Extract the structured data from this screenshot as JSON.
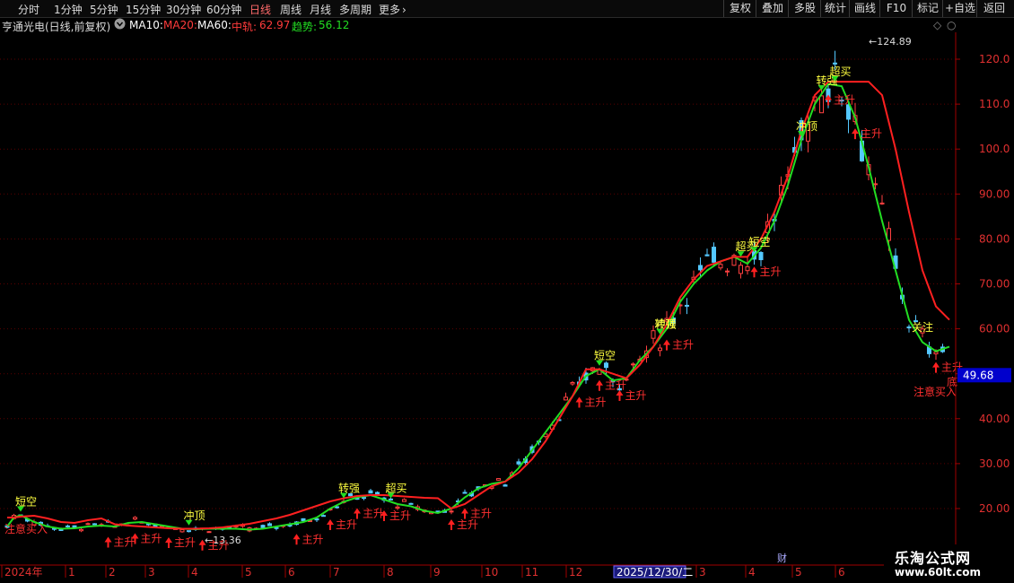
{
  "toolbar": {
    "periods": [
      {
        "label": "分时"
      },
      {
        "label": "1分钟"
      },
      {
        "label": "5分钟"
      },
      {
        "label": "15分钟"
      },
      {
        "label": "30分钟"
      },
      {
        "label": "60分钟"
      },
      {
        "label": "日线",
        "active": true
      },
      {
        "label": "周线"
      },
      {
        "label": "月线"
      },
      {
        "label": "多周期"
      },
      {
        "label": "更多"
      }
    ],
    "more_icon": "chevron-right-icon",
    "right_buttons": [
      {
        "label": "复权"
      },
      {
        "label": "叠加"
      },
      {
        "label": "多股"
      },
      {
        "label": "统计"
      },
      {
        "label": "画线"
      },
      {
        "label": "F10"
      },
      {
        "label": "标记"
      },
      {
        "label": "+自选"
      },
      {
        "label": "返回"
      }
    ]
  },
  "info": {
    "stock_title": "亨通光电(日线,前复权)",
    "settings_icon": "gear-icon",
    "ma10": "MA10:",
    "ma20": "MA20:",
    "ma60": "MA60:",
    "mid_label": "中轨:",
    "mid_value": "62.97",
    "trend_label": "趋势:",
    "trend_value": "56.12",
    "corner_icons": [
      "diamond-icon",
      "expand-icon"
    ]
  },
  "chart_data": {
    "type": "candlestick",
    "y_ticks": [
      "20.00",
      "30.00",
      "40.00",
      "50.00",
      "60.00",
      "70.00",
      "80.00",
      "90.00",
      "100.0",
      "110.0",
      "120.0"
    ],
    "y_range": [
      13,
      128
    ],
    "x_labels": [
      "2024年",
      "1",
      "2",
      "3",
      "4",
      "5",
      "6",
      "7",
      "8",
      "9",
      "10",
      "11",
      "12",
      "2025/12/30/二",
      "3",
      "4",
      "5",
      "6"
    ],
    "current_price_tag": "49.68",
    "high_marker": "←124.89",
    "low_marker": "←13.36",
    "grid": true,
    "series": [
      {
        "name": "趋势",
        "color": "#22dd22",
        "points": [
          [
            0,
            16
          ],
          [
            0.5,
            18
          ],
          [
            1,
            18.5
          ],
          [
            2,
            17
          ],
          [
            3,
            16
          ],
          [
            4,
            15.5
          ],
          [
            5,
            15.6
          ],
          [
            6,
            16
          ],
          [
            7,
            16.2
          ],
          [
            8,
            16
          ],
          [
            9,
            16.8
          ],
          [
            10,
            17
          ],
          [
            11,
            16.5
          ],
          [
            12,
            16
          ],
          [
            13,
            15.5
          ],
          [
            14,
            15.4
          ],
          [
            15,
            15.5
          ],
          [
            16,
            15.5
          ],
          [
            17,
            15.5
          ],
          [
            18,
            15.3
          ],
          [
            19,
            15.5
          ],
          [
            20,
            16
          ],
          [
            21,
            16.5
          ],
          [
            22,
            17
          ],
          [
            23,
            18
          ],
          [
            24,
            20
          ],
          [
            25,
            21.5
          ],
          [
            26,
            22.5
          ],
          [
            27,
            23
          ],
          [
            28,
            22
          ],
          [
            29,
            21
          ],
          [
            30,
            20.5
          ],
          [
            31,
            19.5
          ],
          [
            32,
            19
          ],
          [
            33,
            20
          ],
          [
            34,
            22.5
          ],
          [
            35,
            24.5
          ],
          [
            36,
            25.5
          ],
          [
            37,
            26
          ],
          [
            38,
            29
          ],
          [
            39,
            33
          ],
          [
            40,
            37
          ],
          [
            41,
            41
          ],
          [
            42,
            45
          ],
          [
            43,
            49.5
          ],
          [
            44,
            51
          ],
          [
            45,
            48.5
          ],
          [
            46,
            49
          ],
          [
            47,
            53
          ],
          [
            48,
            56
          ],
          [
            49,
            60
          ],
          [
            50,
            66
          ],
          [
            51,
            70
          ],
          [
            52,
            73
          ],
          [
            53,
            75
          ],
          [
            54,
            76
          ],
          [
            55,
            74.5
          ],
          [
            56,
            78
          ],
          [
            57,
            84
          ],
          [
            58,
            92
          ],
          [
            59,
            102
          ],
          [
            60,
            110
          ],
          [
            61,
            114.5
          ],
          [
            62,
            114
          ],
          [
            63,
            107
          ],
          [
            64,
            96
          ],
          [
            65,
            84
          ],
          [
            66,
            73
          ],
          [
            67,
            62
          ],
          [
            68,
            57
          ],
          [
            69,
            55
          ],
          [
            70,
            56
          ]
        ]
      },
      {
        "name": "中轨",
        "color": "#ff2020",
        "points": [
          [
            0,
            18
          ],
          [
            0.5,
            18
          ],
          [
            1,
            18.2
          ],
          [
            2,
            18.4
          ],
          [
            3,
            17.8
          ],
          [
            4,
            17
          ],
          [
            5,
            16.8
          ],
          [
            6,
            17.4
          ],
          [
            7,
            17.8
          ],
          [
            8,
            16.5
          ],
          [
            9,
            16.2
          ],
          [
            10,
            16
          ],
          [
            11,
            15.8
          ],
          [
            12,
            15.6
          ],
          [
            13,
            15.5
          ],
          [
            14,
            15.5
          ],
          [
            15,
            15.6
          ],
          [
            16,
            15.8
          ],
          [
            17,
            16.2
          ],
          [
            18,
            16.6
          ],
          [
            19,
            17.2
          ],
          [
            20,
            17.8
          ],
          [
            21,
            18.6
          ],
          [
            22,
            19.6
          ],
          [
            23,
            20.6
          ],
          [
            24,
            21.6
          ],
          [
            25,
            22.3
          ],
          [
            26,
            22.8
          ],
          [
            27,
            23
          ],
          [
            28,
            23
          ],
          [
            29,
            22.8
          ],
          [
            30,
            22.6
          ],
          [
            31,
            22.4
          ],
          [
            32,
            22.3
          ],
          [
            33,
            20
          ],
          [
            34,
            21
          ],
          [
            35,
            23
          ],
          [
            36,
            25
          ],
          [
            37,
            26
          ],
          [
            38,
            28
          ],
          [
            39,
            31
          ],
          [
            40,
            35
          ],
          [
            41,
            40
          ],
          [
            42,
            45
          ],
          [
            43,
            51
          ],
          [
            44,
            51
          ],
          [
            45,
            50
          ],
          [
            46,
            49
          ],
          [
            47,
            52
          ],
          [
            48,
            56
          ],
          [
            49,
            61
          ],
          [
            50,
            67
          ],
          [
            51,
            71
          ],
          [
            52,
            74
          ],
          [
            53,
            75
          ],
          [
            54,
            76
          ],
          [
            55,
            76
          ],
          [
            56,
            80
          ],
          [
            57,
            86
          ],
          [
            58,
            94
          ],
          [
            59,
            104
          ],
          [
            60,
            112
          ],
          [
            61,
            115
          ],
          [
            62,
            115
          ],
          [
            63,
            115
          ],
          [
            64,
            115
          ],
          [
            65,
            112
          ],
          [
            66,
            100
          ],
          [
            67,
            86
          ],
          [
            68,
            73
          ],
          [
            69,
            65
          ],
          [
            70,
            62
          ]
        ]
      }
    ],
    "signals": {
      "red_arrows_text": "主升",
      "yellow_labels": [
        "短空",
        "冲顶",
        "转强",
        "超买"
      ],
      "bottom_labels": [
        "注意买入",
        "底"
      ],
      "other_labels": [
        "关注"
      ]
    },
    "badge": "财"
  },
  "watermark": {
    "line1": "乐淘公式网",
    "line2": "www.60lt.com"
  }
}
